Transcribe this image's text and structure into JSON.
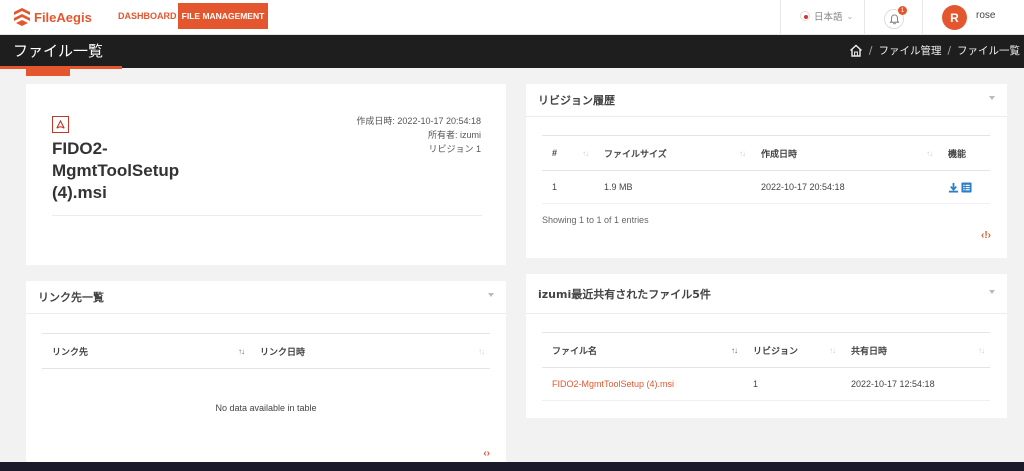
{
  "topnav": {
    "logo": "FileAegis",
    "dashboard": "DASHBOARD",
    "file_management": "FILE MANAGEMENT",
    "language": "日本語",
    "notification_count": "1",
    "avatar_initial": "R",
    "username": "rose"
  },
  "header": {
    "title": "ファイル一覧",
    "breadcrumb": [
      "ファイル管理",
      "ファイル一覧"
    ]
  },
  "file_info": {
    "name": "FIDO2-MgmtToolSetup (4).msi",
    "name_lines": [
      "FIDO2-",
      "MgmtToolSetup",
      "(4).msi"
    ],
    "created_label": "作成日時",
    "created_value": "2022-10-17 20:54:18",
    "owner_label": "所有者",
    "owner_value": "izumi",
    "revision_label": "リビジョン",
    "revision_value": "1"
  },
  "revision_history": {
    "title": "リビジョン履歴",
    "columns": [
      "#",
      "ファイルサイズ",
      "作成日時",
      "機能"
    ],
    "rows": [
      {
        "num": "1",
        "size": "1.9 MB",
        "created": "2022-10-17 20:54:18"
      }
    ],
    "entries_info": "Showing 1 to 1 of 1 entries"
  },
  "links": {
    "title": "リンク先一覧",
    "columns": [
      "リンク先",
      "リンク日時"
    ],
    "empty_message": "No data available in table"
  },
  "recent_shared": {
    "title": "izumi最近共有されたファイル5件",
    "columns": [
      "ファイル名",
      "リビジョン",
      "共有日時"
    ],
    "rows": [
      {
        "file": "FIDO2-MgmtToolSetup (4).msi",
        "revision": "1",
        "shared": "2022-10-17 12:54:18"
      }
    ]
  },
  "colors": {
    "accent": "#e4572e",
    "header_bg": "#1e1e1e",
    "page_bg": "#f2f2f2",
    "action_blue": "#2a7fc6"
  },
  "icons": [
    "logo-icon",
    "flag-icon",
    "chevron-down-icon",
    "bell-icon",
    "home-icon",
    "pdf-icon",
    "download-icon",
    "list-icon",
    "sort-icon",
    "pager-icon"
  ]
}
